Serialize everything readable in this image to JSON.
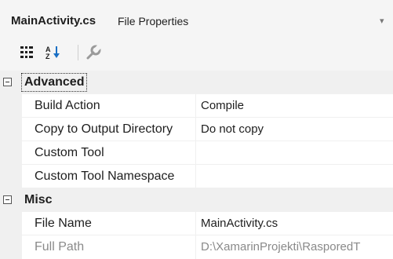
{
  "header": {
    "file_name": "MainActivity.cs",
    "panel_title": "File Properties",
    "dropdown_glyph": "▾"
  },
  "toolbar": {
    "categorized_icon": "categorized-view-icon",
    "alphabetical_icon": "alphabetical-sort-icon",
    "property_pages_icon": "wrench-icon"
  },
  "categories": [
    {
      "label": "Advanced",
      "properties": [
        {
          "name": "Build Action",
          "value": "Compile"
        },
        {
          "name": "Copy to Output Directory",
          "value": "Do not copy"
        },
        {
          "name": "Custom Tool",
          "value": ""
        },
        {
          "name": "Custom Tool Namespace",
          "value": ""
        }
      ]
    },
    {
      "label": "Misc",
      "properties": [
        {
          "name": "File Name",
          "value": "MainActivity.cs"
        },
        {
          "name": "Full Path",
          "value": "D:\\XamarinProjekti\\RasporedT"
        }
      ]
    }
  ],
  "colors": {
    "header_bg": "#f5f5f5",
    "gutter_bg": "#f0f0f0",
    "text": "#1e1e1e",
    "disabled_text": "#8a8a8a"
  }
}
